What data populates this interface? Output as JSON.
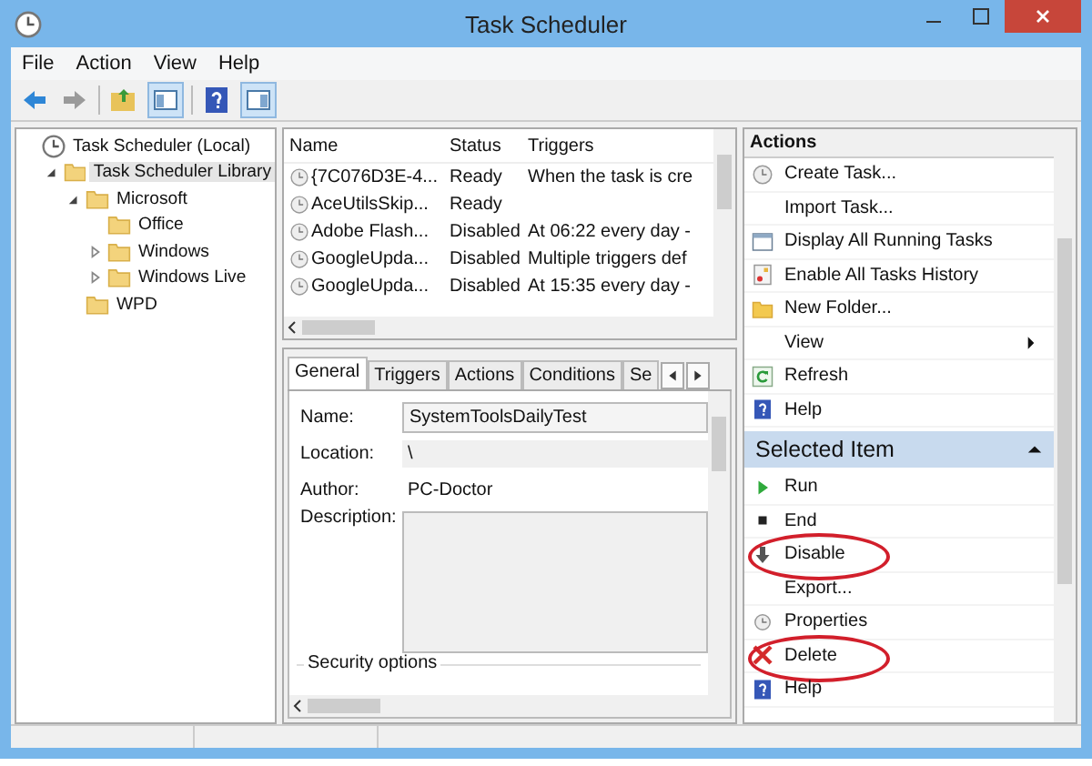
{
  "window": {
    "title": "Task Scheduler"
  },
  "menu": [
    "File",
    "Action",
    "View",
    "Help"
  ],
  "tree": [
    {
      "label": "Task Scheduler (Local)",
      "selected": false,
      "children": [
        {
          "label": "Task Scheduler Library",
          "selected": true,
          "expanded": true,
          "children": [
            {
              "label": "Microsoft",
              "selected": false,
              "expanded": true,
              "children": [
                {
                  "label": "Office",
                  "selected": false
                },
                {
                  "label": "Windows",
                  "selected": false,
                  "expanded": false
                },
                {
                  "label": "Windows Live",
                  "selected": false,
                  "expanded": false
                }
              ]
            },
            {
              "label": "WPD",
              "selected": false
            }
          ]
        }
      ]
    }
  ],
  "task_table": {
    "columns": [
      "Name",
      "Status",
      "Triggers"
    ],
    "rows": [
      {
        "name": "{7C076D3E-4...",
        "status": "Ready",
        "triggers": "When the task is cre"
      },
      {
        "name": "AceUtilsSkip...",
        "status": "Ready",
        "triggers": ""
      },
      {
        "name": "Adobe Flash...",
        "status": "Disabled",
        "triggers": "At 06:22 every day -"
      },
      {
        "name": "GoogleUpda...",
        "status": "Disabled",
        "triggers": "Multiple triggers def"
      },
      {
        "name": "GoogleUpda...",
        "status": "Disabled",
        "triggers": "At 15:35 every day -"
      }
    ]
  },
  "detail_tabs": [
    {
      "label": "General",
      "selected": true
    },
    {
      "label": "Triggers",
      "selected": false
    },
    {
      "label": "Actions",
      "selected": false
    },
    {
      "label": "Conditions",
      "selected": false
    },
    {
      "label": "Se",
      "selected": false
    }
  ],
  "general": {
    "name_label": "Name:",
    "name_value": "SystemToolsDailyTest",
    "location_label": "Location:",
    "location_value": "\\",
    "author_label": "Author:",
    "author_value": "PC-Doctor",
    "description_label": "Description:",
    "security_label": "Security options"
  },
  "actions_pane": {
    "title": "Actions",
    "items": [
      {
        "label": "Create Task...",
        "kind": "item",
        "highlighted": false
      },
      {
        "label": "Import Task...",
        "kind": "item",
        "highlighted": false
      },
      {
        "label": "Display All Running Tasks",
        "kind": "item",
        "highlighted": false
      },
      {
        "label": "Enable All Tasks History",
        "kind": "item",
        "highlighted": false
      },
      {
        "label": "New Folder...",
        "kind": "item",
        "highlighted": false
      },
      {
        "label": "View",
        "kind": "submenu",
        "highlighted": false
      },
      {
        "label": "Refresh",
        "kind": "item",
        "highlighted": false
      },
      {
        "label": "Help",
        "kind": "item",
        "highlighted": false
      }
    ],
    "section_title": "Selected Item",
    "section_items": [
      {
        "label": "Run",
        "highlighted": false
      },
      {
        "label": "End",
        "highlighted": false
      },
      {
        "label": "Disable",
        "highlighted": true
      },
      {
        "label": "Export...",
        "highlighted": false
      },
      {
        "label": "Properties",
        "highlighted": false
      },
      {
        "label": "Delete",
        "highlighted": true
      },
      {
        "label": "Help",
        "highlighted": false
      }
    ]
  }
}
